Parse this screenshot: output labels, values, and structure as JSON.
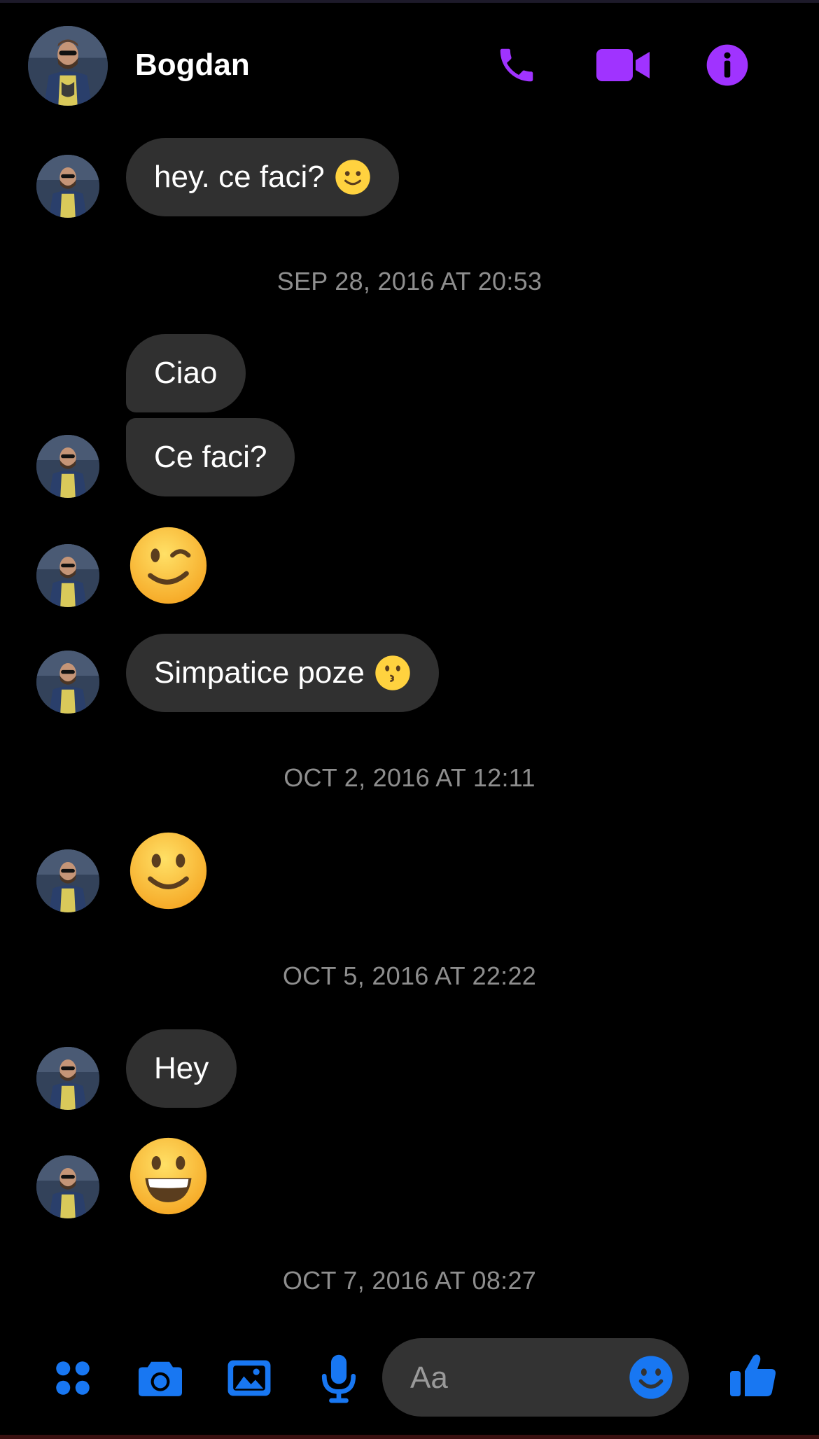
{
  "header": {
    "contact_name": "Bogdan",
    "actions": [
      "phone-icon",
      "video-camera-icon",
      "info-icon"
    ],
    "accent": "#a033ff"
  },
  "messages": [
    {
      "type": "text",
      "text": "hey. ce faci?",
      "emoji": "slightly-smiling-face"
    },
    {
      "type": "timestamp",
      "text": "SEP 28, 2016 AT 20:53"
    },
    {
      "type": "text",
      "text": "Ciao"
    },
    {
      "type": "text",
      "text": "Ce faci?"
    },
    {
      "type": "emoji",
      "emoji": "winking-face"
    },
    {
      "type": "text",
      "text": "Simpatice poze",
      "emoji": "kissing-face"
    },
    {
      "type": "timestamp",
      "text": "OCT 2, 2016 AT 12:11"
    },
    {
      "type": "emoji",
      "emoji": "slightly-smiling-face"
    },
    {
      "type": "timestamp",
      "text": "OCT 5, 2016 AT 22:22"
    },
    {
      "type": "text",
      "text": "Hey"
    },
    {
      "type": "emoji",
      "emoji": "grinning-face"
    },
    {
      "type": "timestamp",
      "text": "OCT 7, 2016 AT 08:27"
    }
  ],
  "composer": {
    "placeholder": "Aa",
    "actions": [
      "apps-icon",
      "camera-icon",
      "gallery-icon",
      "microphone-icon",
      "emoji-icon",
      "thumbs-up-icon"
    ],
    "accent": "#1877f2"
  },
  "colors": {
    "background": "#000000",
    "bubble": "#303030",
    "timestamp": "#8e8e8e"
  }
}
